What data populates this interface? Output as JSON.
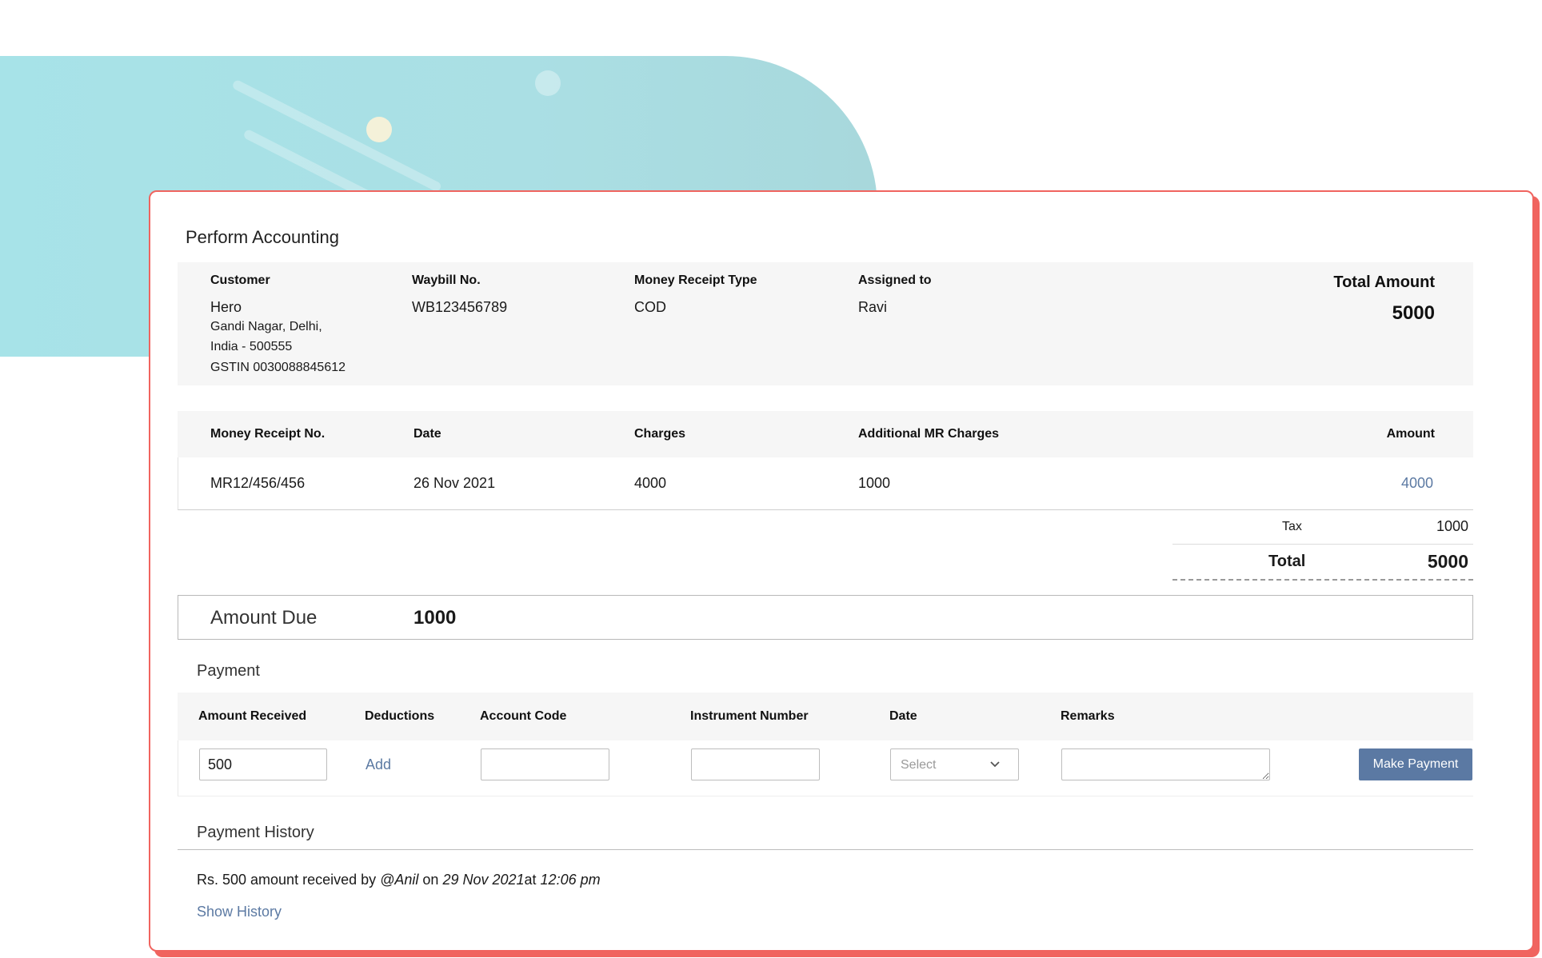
{
  "card": {
    "title": "Perform Accounting"
  },
  "info": {
    "customer_label": "Customer",
    "customer_name": "Hero",
    "address_line1": "Gandi Nagar, Delhi,",
    "address_line2": "India - 500555",
    "gstin": "GSTIN 0030088845612",
    "waybill_label": "Waybill No.",
    "waybill_value": "WB123456789",
    "receipt_type_label": "Money Receipt Type",
    "receipt_type_value": "COD",
    "assigned_label": "Assigned to",
    "assigned_value": "Ravi",
    "total_amount_label": "Total Amount",
    "total_amount_value": "5000"
  },
  "mr_table": {
    "headers": [
      "Money Receipt No.",
      "Date",
      "Charges",
      "Additional MR Charges",
      "Amount"
    ],
    "row": {
      "receipt_no": "MR12/456/456",
      "date": "26 Nov 2021",
      "charges": "4000",
      "additional": "1000",
      "amount": "4000"
    }
  },
  "summary": {
    "tax_label": "Tax",
    "tax_value": "1000",
    "total_label": "Total",
    "total_value": "5000"
  },
  "due": {
    "label": "Amount Due",
    "value": "1000"
  },
  "payment": {
    "title": "Payment",
    "headers": [
      "Amount Received",
      "Deductions",
      "Account Code",
      "Instrument Number",
      "Date",
      "Remarks"
    ],
    "amount_received": "500",
    "deductions_link": "Add",
    "date_placeholder": "Select",
    "button_label": "Make Payment"
  },
  "history": {
    "title": "Payment History",
    "entry": {
      "prefix": "Rs. 500 amount received by ",
      "user": "@Anil",
      "mid": " on ",
      "date": "29 Nov 2021",
      "at": "at ",
      "time": "12:06 pm"
    },
    "show_link": "Show History"
  },
  "colors": {
    "accent": "#f0645f",
    "link": "#5c7aa3",
    "button": "#5b79a3",
    "bg_shape": "#a8e2e6"
  }
}
